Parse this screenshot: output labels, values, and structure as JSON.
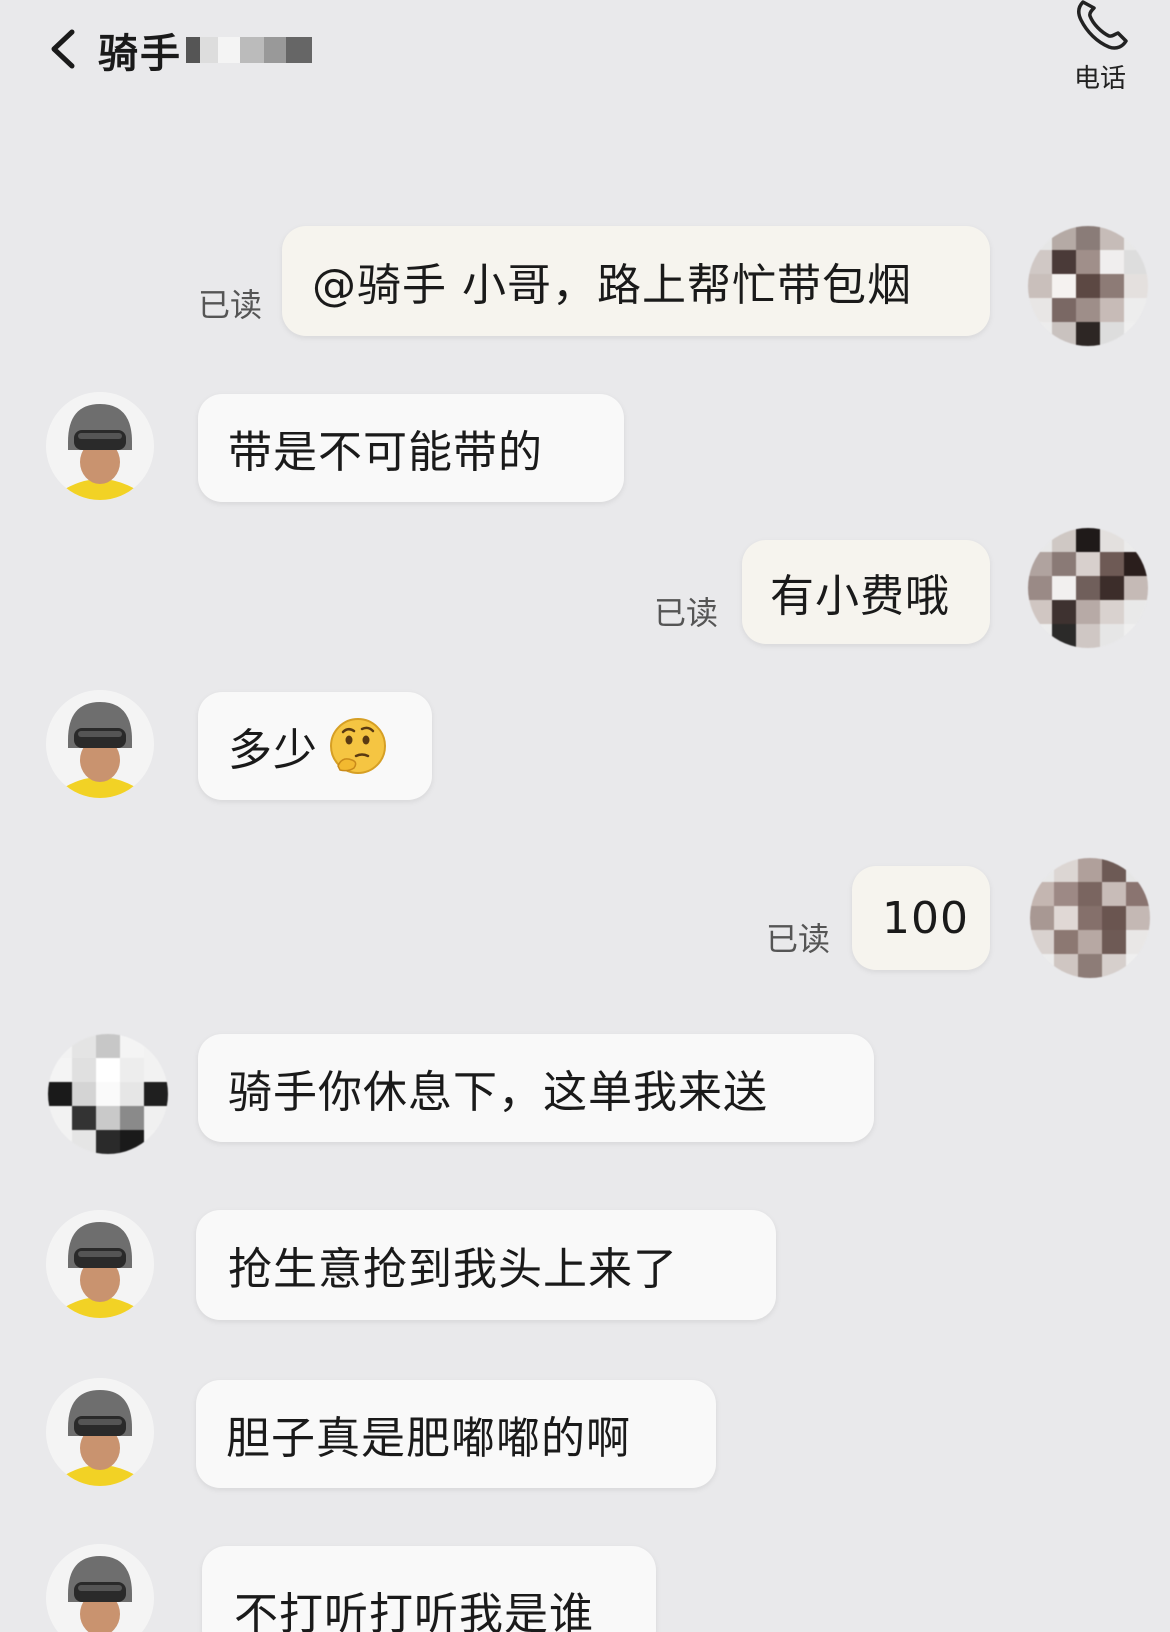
{
  "header": {
    "title": "骑手",
    "call_label": "电话"
  },
  "messages": [
    {
      "side": "mine",
      "text": "@骑手 小哥，路上帮忙带包烟",
      "status": "已读"
    },
    {
      "side": "rider",
      "text": "带是不可能带的"
    },
    {
      "side": "mine",
      "text": "有小费哦",
      "status": "已读"
    },
    {
      "side": "rider",
      "text": "多少",
      "emoji": "thinking-face-emoji"
    },
    {
      "side": "mine",
      "text": "100",
      "status": "已读"
    },
    {
      "side": "other",
      "text": "骑手你休息下，这单我来送"
    },
    {
      "side": "rider",
      "text": "抢生意抢到我头上来了"
    },
    {
      "side": "rider",
      "text": "胆子真是肥嘟嘟的啊"
    },
    {
      "side": "rider",
      "text": "不打听打听我是谁"
    }
  ],
  "colors": {
    "background": "#e9e9eb",
    "bubble": "#f9f9f9",
    "rider_shirt": "#f2d225",
    "helmet": "#6e6e6e"
  }
}
